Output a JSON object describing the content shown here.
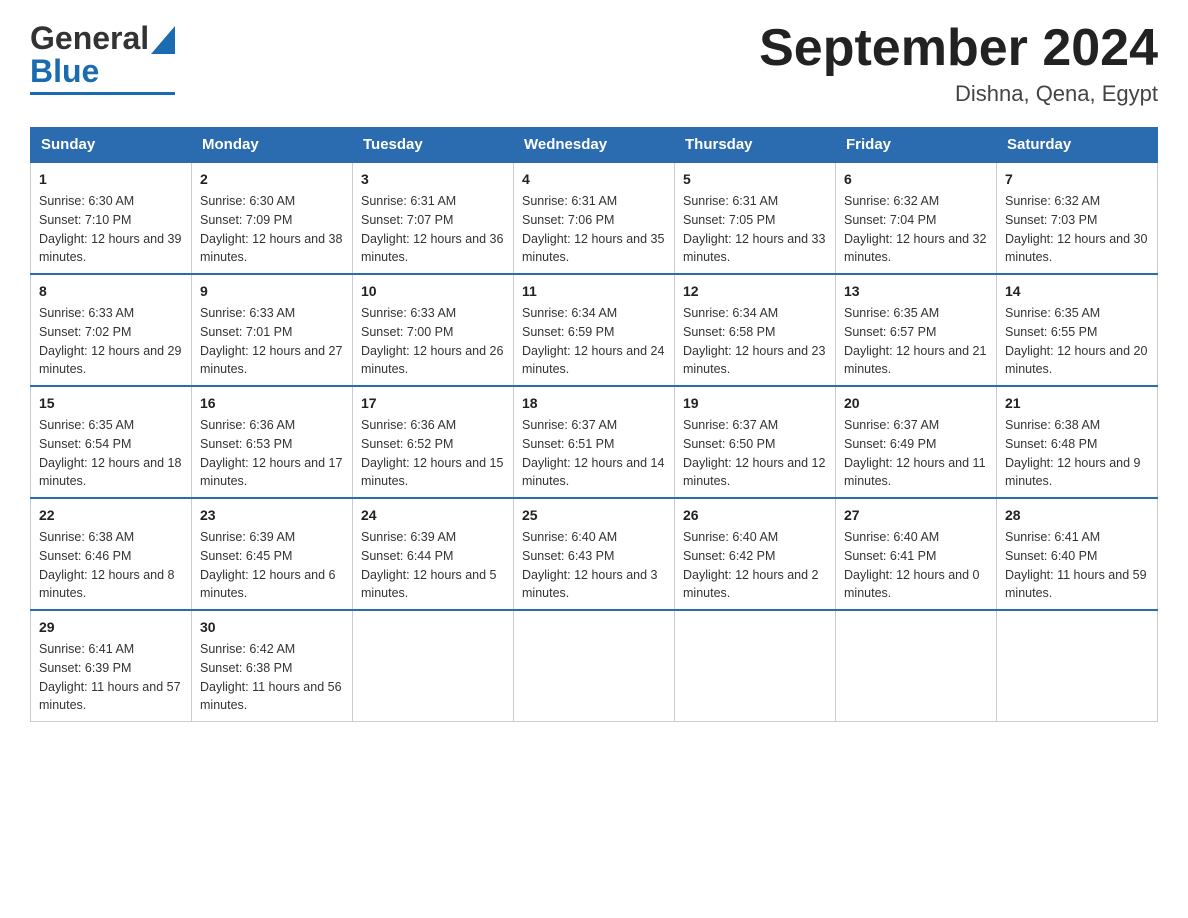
{
  "header": {
    "logo_text_black": "General",
    "logo_text_blue": "Blue",
    "month_title": "September 2024",
    "location": "Dishna, Qena, Egypt"
  },
  "days_of_week": [
    "Sunday",
    "Monday",
    "Tuesday",
    "Wednesday",
    "Thursday",
    "Friday",
    "Saturday"
  ],
  "weeks": [
    [
      {
        "day": "1",
        "sunrise": "Sunrise: 6:30 AM",
        "sunset": "Sunset: 7:10 PM",
        "daylight": "Daylight: 12 hours and 39 minutes."
      },
      {
        "day": "2",
        "sunrise": "Sunrise: 6:30 AM",
        "sunset": "Sunset: 7:09 PM",
        "daylight": "Daylight: 12 hours and 38 minutes."
      },
      {
        "day": "3",
        "sunrise": "Sunrise: 6:31 AM",
        "sunset": "Sunset: 7:07 PM",
        "daylight": "Daylight: 12 hours and 36 minutes."
      },
      {
        "day": "4",
        "sunrise": "Sunrise: 6:31 AM",
        "sunset": "Sunset: 7:06 PM",
        "daylight": "Daylight: 12 hours and 35 minutes."
      },
      {
        "day": "5",
        "sunrise": "Sunrise: 6:31 AM",
        "sunset": "Sunset: 7:05 PM",
        "daylight": "Daylight: 12 hours and 33 minutes."
      },
      {
        "day": "6",
        "sunrise": "Sunrise: 6:32 AM",
        "sunset": "Sunset: 7:04 PM",
        "daylight": "Daylight: 12 hours and 32 minutes."
      },
      {
        "day": "7",
        "sunrise": "Sunrise: 6:32 AM",
        "sunset": "Sunset: 7:03 PM",
        "daylight": "Daylight: 12 hours and 30 minutes."
      }
    ],
    [
      {
        "day": "8",
        "sunrise": "Sunrise: 6:33 AM",
        "sunset": "Sunset: 7:02 PM",
        "daylight": "Daylight: 12 hours and 29 minutes."
      },
      {
        "day": "9",
        "sunrise": "Sunrise: 6:33 AM",
        "sunset": "Sunset: 7:01 PM",
        "daylight": "Daylight: 12 hours and 27 minutes."
      },
      {
        "day": "10",
        "sunrise": "Sunrise: 6:33 AM",
        "sunset": "Sunset: 7:00 PM",
        "daylight": "Daylight: 12 hours and 26 minutes."
      },
      {
        "day": "11",
        "sunrise": "Sunrise: 6:34 AM",
        "sunset": "Sunset: 6:59 PM",
        "daylight": "Daylight: 12 hours and 24 minutes."
      },
      {
        "day": "12",
        "sunrise": "Sunrise: 6:34 AM",
        "sunset": "Sunset: 6:58 PM",
        "daylight": "Daylight: 12 hours and 23 minutes."
      },
      {
        "day": "13",
        "sunrise": "Sunrise: 6:35 AM",
        "sunset": "Sunset: 6:57 PM",
        "daylight": "Daylight: 12 hours and 21 minutes."
      },
      {
        "day": "14",
        "sunrise": "Sunrise: 6:35 AM",
        "sunset": "Sunset: 6:55 PM",
        "daylight": "Daylight: 12 hours and 20 minutes."
      }
    ],
    [
      {
        "day": "15",
        "sunrise": "Sunrise: 6:35 AM",
        "sunset": "Sunset: 6:54 PM",
        "daylight": "Daylight: 12 hours and 18 minutes."
      },
      {
        "day": "16",
        "sunrise": "Sunrise: 6:36 AM",
        "sunset": "Sunset: 6:53 PM",
        "daylight": "Daylight: 12 hours and 17 minutes."
      },
      {
        "day": "17",
        "sunrise": "Sunrise: 6:36 AM",
        "sunset": "Sunset: 6:52 PM",
        "daylight": "Daylight: 12 hours and 15 minutes."
      },
      {
        "day": "18",
        "sunrise": "Sunrise: 6:37 AM",
        "sunset": "Sunset: 6:51 PM",
        "daylight": "Daylight: 12 hours and 14 minutes."
      },
      {
        "day": "19",
        "sunrise": "Sunrise: 6:37 AM",
        "sunset": "Sunset: 6:50 PM",
        "daylight": "Daylight: 12 hours and 12 minutes."
      },
      {
        "day": "20",
        "sunrise": "Sunrise: 6:37 AM",
        "sunset": "Sunset: 6:49 PM",
        "daylight": "Daylight: 12 hours and 11 minutes."
      },
      {
        "day": "21",
        "sunrise": "Sunrise: 6:38 AM",
        "sunset": "Sunset: 6:48 PM",
        "daylight": "Daylight: 12 hours and 9 minutes."
      }
    ],
    [
      {
        "day": "22",
        "sunrise": "Sunrise: 6:38 AM",
        "sunset": "Sunset: 6:46 PM",
        "daylight": "Daylight: 12 hours and 8 minutes."
      },
      {
        "day": "23",
        "sunrise": "Sunrise: 6:39 AM",
        "sunset": "Sunset: 6:45 PM",
        "daylight": "Daylight: 12 hours and 6 minutes."
      },
      {
        "day": "24",
        "sunrise": "Sunrise: 6:39 AM",
        "sunset": "Sunset: 6:44 PM",
        "daylight": "Daylight: 12 hours and 5 minutes."
      },
      {
        "day": "25",
        "sunrise": "Sunrise: 6:40 AM",
        "sunset": "Sunset: 6:43 PM",
        "daylight": "Daylight: 12 hours and 3 minutes."
      },
      {
        "day": "26",
        "sunrise": "Sunrise: 6:40 AM",
        "sunset": "Sunset: 6:42 PM",
        "daylight": "Daylight: 12 hours and 2 minutes."
      },
      {
        "day": "27",
        "sunrise": "Sunrise: 6:40 AM",
        "sunset": "Sunset: 6:41 PM",
        "daylight": "Daylight: 12 hours and 0 minutes."
      },
      {
        "day": "28",
        "sunrise": "Sunrise: 6:41 AM",
        "sunset": "Sunset: 6:40 PM",
        "daylight": "Daylight: 11 hours and 59 minutes."
      }
    ],
    [
      {
        "day": "29",
        "sunrise": "Sunrise: 6:41 AM",
        "sunset": "Sunset: 6:39 PM",
        "daylight": "Daylight: 11 hours and 57 minutes."
      },
      {
        "day": "30",
        "sunrise": "Sunrise: 6:42 AM",
        "sunset": "Sunset: 6:38 PM",
        "daylight": "Daylight: 11 hours and 56 minutes."
      },
      null,
      null,
      null,
      null,
      null
    ]
  ]
}
